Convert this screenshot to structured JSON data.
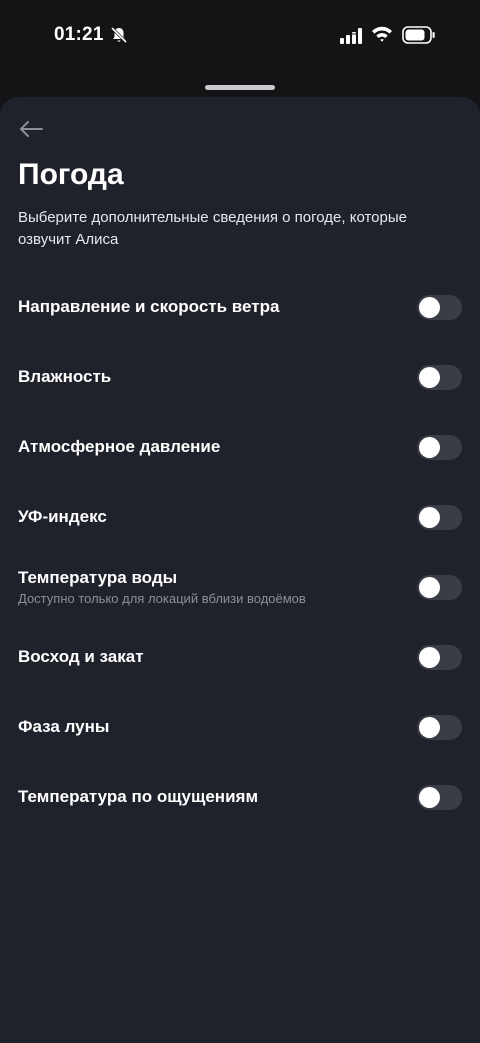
{
  "status_bar": {
    "time": "01:21",
    "icons": [
      "bell-muted-icon",
      "signal-icon",
      "wifi-icon",
      "battery-icon"
    ]
  },
  "header": {
    "back_icon": "arrow-left-icon",
    "title": "Погода",
    "description": "Выберите дополнительные сведения о погоде, которые озвучит Алиса"
  },
  "settings": [
    {
      "label": "Направление и скорость ветра",
      "sub": "",
      "enabled": false
    },
    {
      "label": "Влажность",
      "sub": "",
      "enabled": false
    },
    {
      "label": "Атмосферное давление",
      "sub": "",
      "enabled": false
    },
    {
      "label": "УФ-индекс",
      "sub": "",
      "enabled": false
    },
    {
      "label": "Температура воды",
      "sub": "Доступно только для локаций вблизи водоёмов",
      "enabled": false
    },
    {
      "label": "Восход и закат",
      "sub": "",
      "enabled": false
    },
    {
      "label": "Фаза луны",
      "sub": "",
      "enabled": false
    },
    {
      "label": "Температура по ощущениям",
      "sub": "",
      "enabled": false
    }
  ],
  "colors": {
    "background": "#141417",
    "sheet": "#20222b",
    "toggle_off": "#3a3c46",
    "secondary_text": "#8c8e98"
  }
}
